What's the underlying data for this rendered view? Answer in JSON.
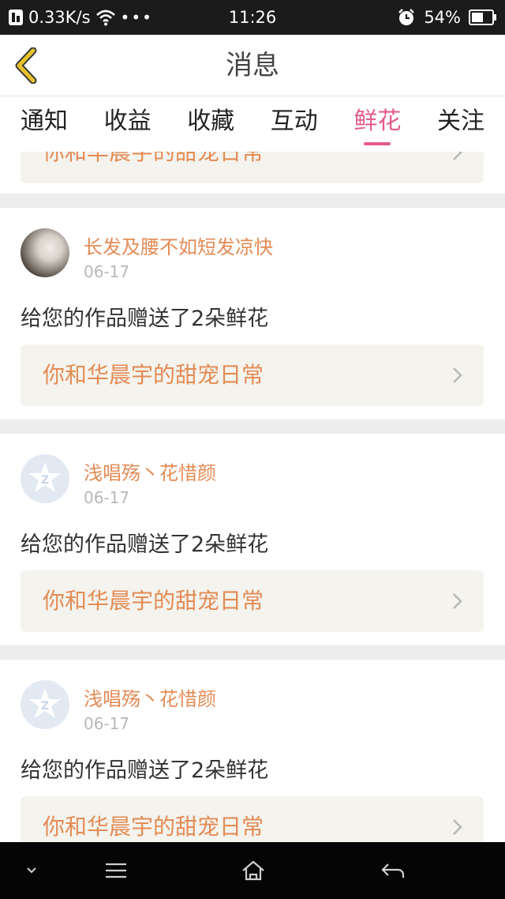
{
  "status_bar": {
    "network_speed": "0.33K/s",
    "time": "11:26",
    "battery_percent": "54%"
  },
  "header": {
    "title": "消息"
  },
  "tabs": [
    {
      "label": "通知",
      "active": false
    },
    {
      "label": "收益",
      "active": false
    },
    {
      "label": "收藏",
      "active": false
    },
    {
      "label": "互动",
      "active": false
    },
    {
      "label": "鲜花",
      "active": true
    },
    {
      "label": "关注",
      "active": false
    }
  ],
  "messages": [
    {
      "username": "",
      "date": "",
      "text": "",
      "book_title": "你和华晨宇的甜宠日常"
    },
    {
      "username": "长发及腰不如短发凉快",
      "date": "06-17",
      "text": "给您的作品赠送了2朵鲜花",
      "book_title": "你和华晨宇的甜宠日常"
    },
    {
      "username": "浅唱殇丶花惜颜",
      "date": "06-17",
      "text": "给您的作品赠送了2朵鲜花",
      "book_title": "你和华晨宇的甜宠日常"
    },
    {
      "username": "浅唱殇丶花惜颜",
      "date": "06-17",
      "text": "给您的作品赠送了2朵鲜花",
      "book_title": "你和华晨宇的甜宠日常"
    }
  ],
  "colors": {
    "accent": "#e45b8c",
    "username": "#e48b55",
    "back_icon": "#e6c229"
  },
  "icons": {
    "back": "chevron-left-icon",
    "book_link": "chevron-right-icon",
    "nav_down": "chevron-down-icon",
    "nav_menu": "menu-icon",
    "nav_home": "home-icon",
    "nav_back": "back-arrow-icon"
  }
}
